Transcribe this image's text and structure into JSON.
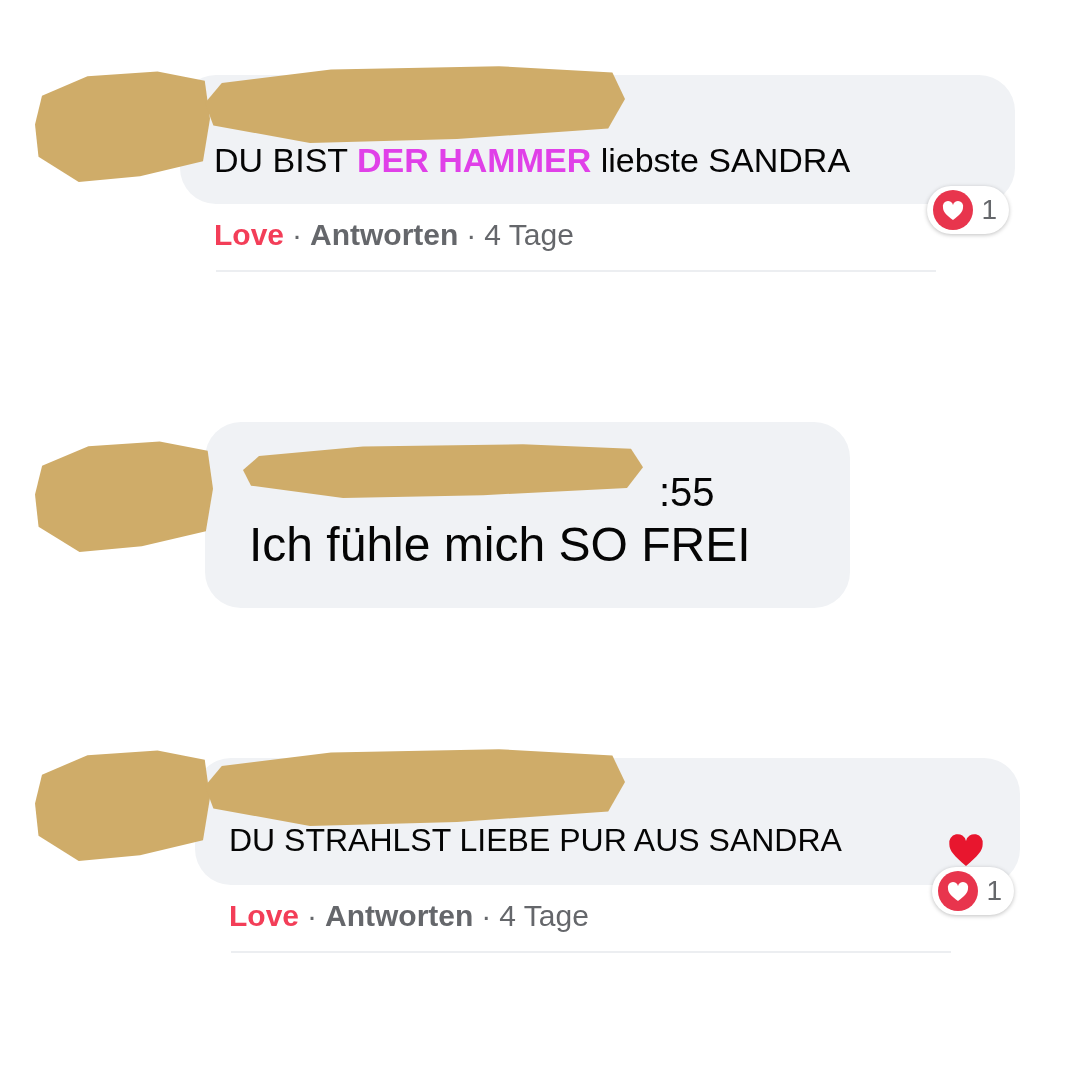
{
  "comments": [
    {
      "text": "DU BIST **DER HAMMER** liebste SANDRA",
      "reaction": {
        "count": "1"
      },
      "actions": [
        {
          "kind": "reaction",
          "label": "Love"
        },
        {
          "kind": "sep",
          "label": "·"
        },
        {
          "kind": "link",
          "label": "Antworten"
        },
        {
          "kind": "sep",
          "label": "·"
        },
        {
          "kind": "time",
          "label": "4 Tage"
        }
      ]
    },
    {
      "author_tail": ":55",
      "text": "Ich fühle mich SO FREI"
    },
    {
      "text": "DU STRAHLST LIEBE PUR AUS SANDRA",
      "heart": true,
      "reaction": {
        "count": "1"
      },
      "actions": [
        {
          "kind": "reaction",
          "label": "Love"
        },
        {
          "kind": "sep",
          "label": "·"
        },
        {
          "kind": "link",
          "label": "Antworten"
        },
        {
          "kind": "sep",
          "label": "·"
        },
        {
          "kind": "time",
          "label": "4 Tage"
        }
      ]
    }
  ]
}
